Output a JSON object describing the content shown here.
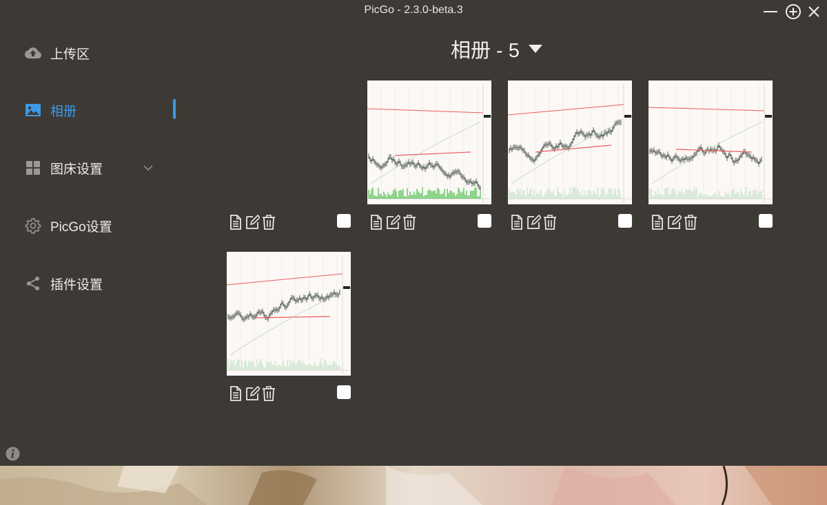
{
  "window": {
    "title": "PicGo - 2.3.0-beta.3",
    "controls": [
      "minimize-icon",
      "plus-circle-icon",
      "close-icon"
    ]
  },
  "sidebar": {
    "items": [
      {
        "label": "上传区",
        "icon": "upload-cloud-icon",
        "active": false
      },
      {
        "label": "相册",
        "icon": "image-icon",
        "active": true
      },
      {
        "label": "图床设置",
        "icon": "grid-icon",
        "active": false,
        "expandable": true
      },
      {
        "label": "PicGo设置",
        "icon": "gear-icon",
        "active": false
      },
      {
        "label": "插件设置",
        "icon": "share-icon",
        "active": false
      }
    ],
    "accent_color": "#3d9ae8"
  },
  "gallery": {
    "title": "相册 - 5",
    "images": [
      {
        "id": 1,
        "checked": false
      },
      {
        "id": 2,
        "checked": false
      },
      {
        "id": 3,
        "checked": false
      },
      {
        "id": 4,
        "checked": false
      },
      {
        "id": 5,
        "checked": false
      }
    ],
    "actions": [
      "copy-document-icon",
      "edit-icon",
      "delete-icon"
    ]
  },
  "colors": {
    "background": "#3d3a35",
    "text": "#ececec"
  }
}
